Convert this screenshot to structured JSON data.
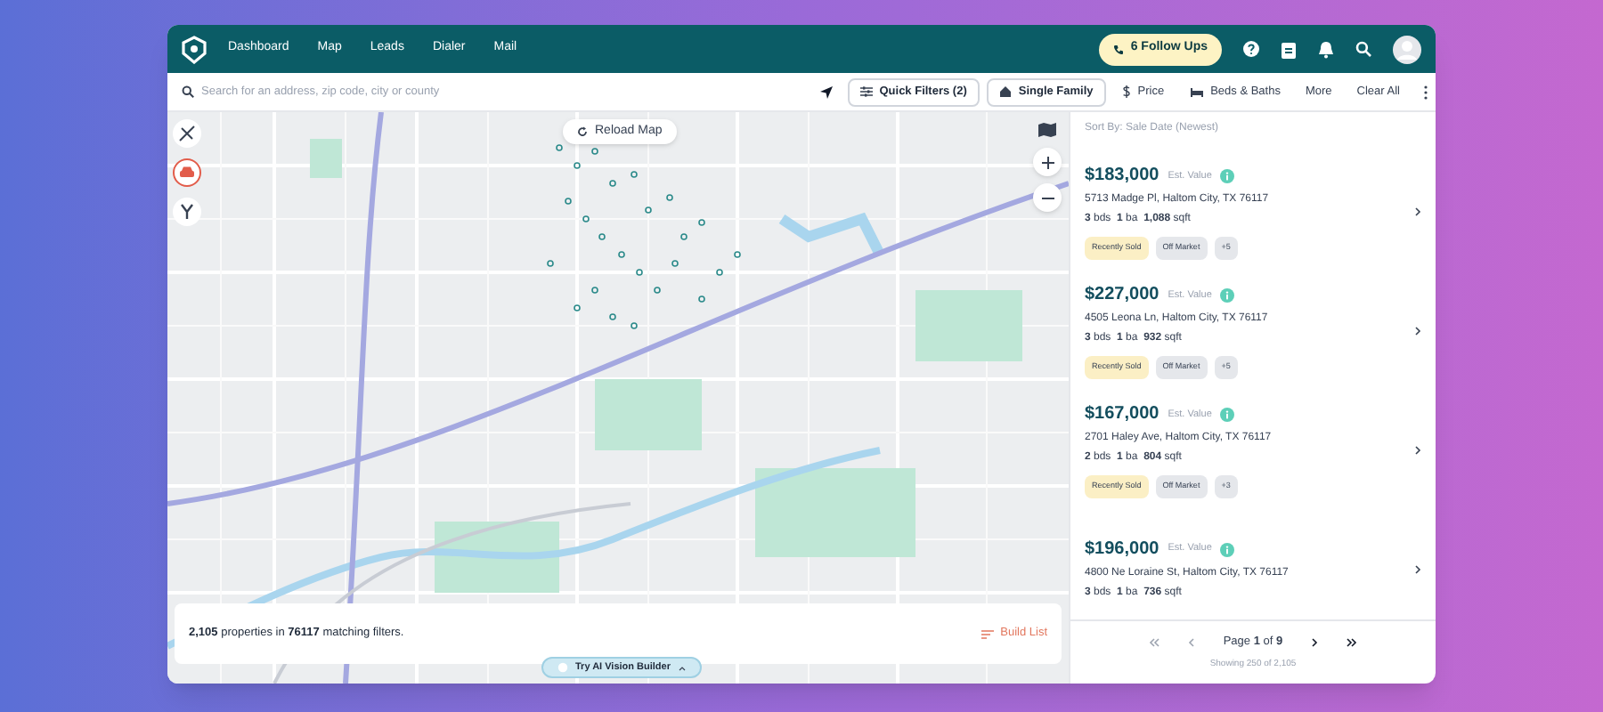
{
  "nav": {
    "items": [
      "Dashboard",
      "Map",
      "Leads",
      "Dialer",
      "Mail"
    ],
    "follow_ups": "6 Follow Ups"
  },
  "search": {
    "placeholder": "Search for an address, zip code, city or county"
  },
  "filters": [
    {
      "label": "Quick Filters (2)",
      "kind": "outlined"
    },
    {
      "label": "Single Family",
      "kind": "outlined"
    },
    {
      "label": "Price",
      "kind": "plain"
    },
    {
      "label": "Beds & Baths",
      "kind": "plain"
    },
    {
      "label": "More",
      "kind": "plain"
    },
    {
      "label": "Clear All",
      "kind": "plain"
    }
  ],
  "map": {
    "reload": "Reload Map",
    "summary": "**2,105** properties in **76117** matching filters.",
    "build_list": "Build List",
    "ai_button": "Try AI Vision Builder"
  },
  "sort": "Sort By: Sale Date (Newest)",
  "listings": [
    {
      "price": "$183,000",
      "est": "Est. Value",
      "address": "5713 Madge Pl, Haltom City, TX 76117",
      "details": "**3** bds  **1** ba  **1,088** sqft",
      "tags": [
        {
          "label": "Recently Sold",
          "kind": "sold"
        },
        {
          "label": "Off Market",
          "kind": "status"
        },
        {
          "label": "+5",
          "kind": "more"
        }
      ]
    },
    {
      "price": "$227,000",
      "est": "Est. Value",
      "address": "4505 Leona Ln, Haltom City, TX 76117",
      "details": "**3** bds  **1** ba  **932** sqft",
      "tags": [
        {
          "label": "Recently Sold",
          "kind": "sold"
        },
        {
          "label": "Off Market",
          "kind": "status"
        },
        {
          "label": "+5",
          "kind": "more"
        }
      ]
    },
    {
      "price": "$167,000",
      "est": "Est. Value",
      "address": "2701 Haley Ave, Haltom City, TX 76117",
      "details": "**2** bds  **1** ba  **804** sqft",
      "tags": [
        {
          "label": "Recently Sold",
          "kind": "sold"
        },
        {
          "label": "Off Market",
          "kind": "status"
        },
        {
          "label": "+3",
          "kind": "more"
        }
      ]
    },
    {
      "price": "$196,000",
      "est": "Est. Value",
      "address": "4800 Ne Loraine St, Haltom City, TX 76117",
      "details": "**3** bds  **1** ba  **736** sqft"
    }
  ],
  "pagination": {
    "page": "Page **1** of **9**",
    "showing": "Showing 250 of 2,105"
  }
}
